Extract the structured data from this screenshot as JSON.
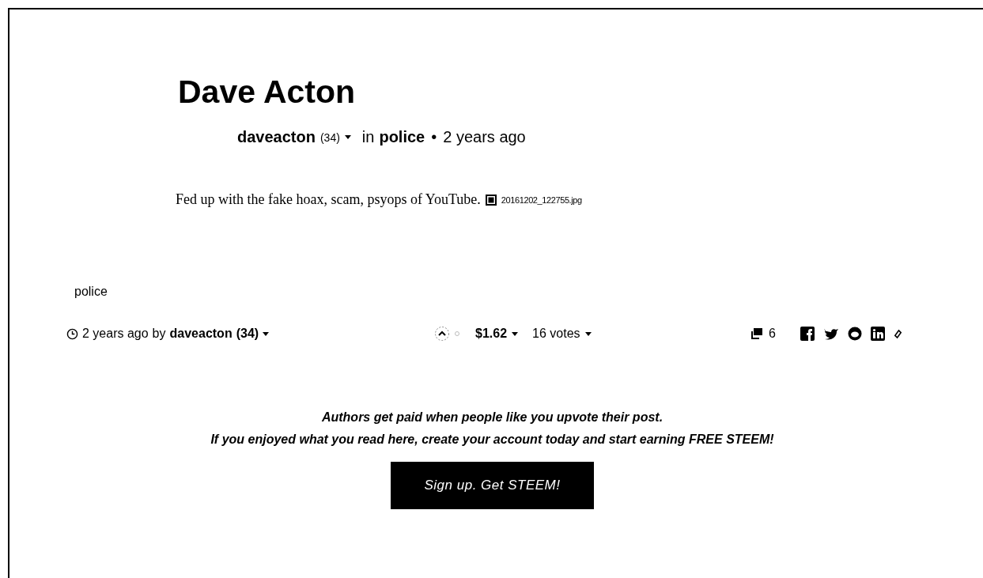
{
  "post": {
    "title": "Dave Acton",
    "author": "daveacton",
    "reputation": "(34)",
    "category_prefix": "in",
    "category": "police",
    "separator": "•",
    "age": "2 years ago",
    "body": "Fed up with the fake hoax, scam, psyops of YouTube.",
    "image_alt": "20161202_122755.jpg"
  },
  "tags": [
    "police"
  ],
  "footer": {
    "age": "2 years ago",
    "by": "by",
    "author": "daveacton",
    "reputation": "(34)",
    "payout": "$1.62",
    "votes": "16 votes",
    "comments": "6"
  },
  "cta": {
    "lines": [
      "Authors get paid when people like you upvote their post.",
      "If you enjoyed what you read here, create your account today and start earning FREE STEEM!"
    ],
    "button": "Sign up. Get STEEM!"
  }
}
